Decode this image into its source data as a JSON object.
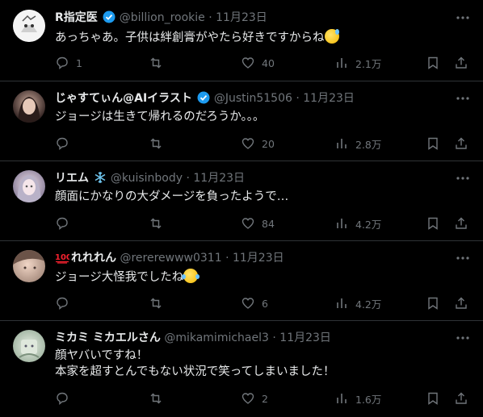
{
  "tweets": [
    {
      "name": "R指定医",
      "handle": "@billion_rookie",
      "dot": "·",
      "date": "11月23日",
      "verified": true,
      "name_emoji": "",
      "text": "あっちゃあ。子供は絆創膏がやたら好きですからね",
      "text_emoji": "sweat-smile-emoji",
      "replies": "1",
      "retweets": "",
      "likes": "40",
      "views": "2.1万"
    },
    {
      "name": "じゃすてぃん@AIイラスト",
      "handle": "@Justin51506",
      "dot": "·",
      "date": "11月23日",
      "verified": true,
      "name_emoji": "",
      "text": "ジョージは生きて帰れるのだろうか。。。",
      "text_emoji": "",
      "replies": "",
      "retweets": "",
      "likes": "20",
      "views": "2.8万"
    },
    {
      "name": "リエム",
      "handle": "@kuisinbody",
      "dot": "·",
      "date": "11月23日",
      "verified": false,
      "name_emoji": "snowflake-emoji",
      "text": "顔面にかなりの大ダメージを負ったようで…",
      "text_emoji": "",
      "replies": "",
      "retweets": "",
      "likes": "84",
      "views": "4.2万"
    },
    {
      "name": "れれれん",
      "handle": "@rererewww0311",
      "dot": "·",
      "date": "11月23日",
      "verified": false,
      "name_emoji": "hundred-points-emoji",
      "text": "ジョージ大怪我でしたね",
      "text_emoji": "tears-of-joy-emoji",
      "replies": "",
      "retweets": "",
      "likes": "6",
      "views": "4.2万"
    },
    {
      "name": "ミカミ ミカエルさん",
      "handle": "@mikamimichael3",
      "dot": "·",
      "date": "11月23日",
      "verified": false,
      "name_emoji": "",
      "text": "顔ヤバいですね！\n本家を超すとんでもない状況で笑ってしまいました！",
      "text_emoji": "",
      "replies": "",
      "retweets": "",
      "likes": "2",
      "views": "1.6万"
    }
  ],
  "colors": {
    "background": "#000000",
    "text": "#e7e9ea",
    "muted": "#71767b",
    "verified": "#1d9bf0",
    "divider": "#2f3336"
  }
}
